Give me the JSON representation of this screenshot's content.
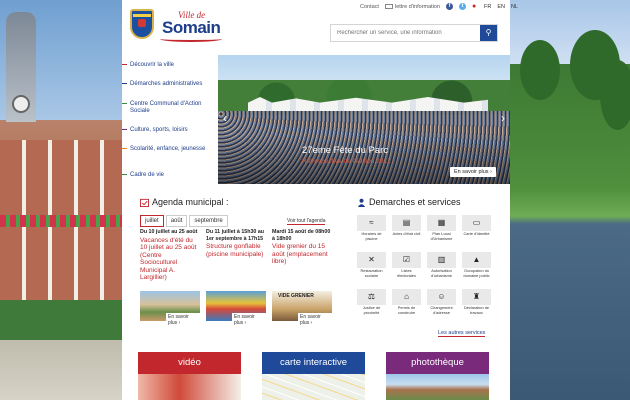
{
  "header": {
    "logo_prefix": "Ville de",
    "logo_name": "Somain",
    "utility": {
      "contact": "Contact",
      "newsletter": "lettre d'information",
      "languages": [
        "FR",
        "EN",
        "NL"
      ]
    },
    "search": {
      "placeholder": "Rechercher un service, une information"
    }
  },
  "sidebar": {
    "items": [
      {
        "label": "Découvrir la ville",
        "color": "#c1272d"
      },
      {
        "label": "Démarches administratives",
        "color": "#1e3d8a"
      },
      {
        "label": "Centre Communal d'Action Sociale",
        "color": "#3a8c3a"
      },
      {
        "label": "Culture, sports, loisirs",
        "color": "#7a2a7a"
      },
      {
        "label": "Scolarité, enfance, jeunesse",
        "color": "#e58a1f"
      },
      {
        "label": "Cadre de vie",
        "color": "#3a8c3a"
      }
    ]
  },
  "hero": {
    "title": "27eme Fête du Parc",
    "subtitle": "Rétrospective de l'édition 2017",
    "more_label": "En savoir plus  ›"
  },
  "agenda": {
    "title": "Agenda municipal :",
    "months": [
      "juillet",
      "août",
      "septembre"
    ],
    "active_month": "juillet",
    "view_all": "Voir tout l'agenda",
    "events": [
      {
        "date": "Du 10 juillet au 25 août",
        "title": "Vacances d'été du 10 juillet au 25 août (Centre Socioculturel Municipal A. Largillier)",
        "more": "En savoir plus  ›"
      },
      {
        "date": "Du 11 juillet à 15h30 au 1er septembre à 17h15",
        "title": "Structure gonflable (piscine municipale)",
        "more": "En savoir plus  ›"
      },
      {
        "date": "Mardi 15 août de 08h00 à 18h00",
        "title": "Vide grenier du 15 août (emplacement libre)",
        "more": "En savoir plus  ›",
        "thumb_text": "VIDE GRENIER"
      }
    ]
  },
  "demarches": {
    "title": "Demarches et services",
    "items": [
      {
        "label": "Horaires de piscine",
        "icon": "pool-icon",
        "glyph": "≈"
      },
      {
        "label": "Actes d'état civil",
        "icon": "document-icon",
        "glyph": "▤"
      },
      {
        "label": "Plan Local d'Urbanisme",
        "icon": "map-icon",
        "glyph": "▦"
      },
      {
        "label": "Carte d'identité",
        "icon": "id-card-icon",
        "glyph": "▭"
      },
      {
        "label": "Restauration scolaire",
        "icon": "cutlery-icon",
        "glyph": "✕"
      },
      {
        "label": "Listes électorales",
        "icon": "ballot-icon",
        "glyph": "☑"
      },
      {
        "label": "Autorisation d'urbanisme",
        "icon": "building-icon",
        "glyph": "▥"
      },
      {
        "label": "Occupation du domaine public",
        "icon": "tent-icon",
        "glyph": "▲"
      },
      {
        "label": "Justice de proximité",
        "icon": "scales-icon",
        "glyph": "⚖"
      },
      {
        "label": "Permis de construire",
        "icon": "house-icon",
        "glyph": "⌂"
      },
      {
        "label": "Changement d'adresse",
        "icon": "people-icon",
        "glyph": "☺"
      },
      {
        "label": "Déclaration de travaux",
        "icon": "tower-icon",
        "glyph": "♜"
      }
    ],
    "more": "Les autres services"
  },
  "tiles": [
    {
      "label": "vidéo",
      "color": "#c1272d"
    },
    {
      "label": "carte interactive",
      "color": "#1e4a99"
    },
    {
      "label": "photothèque",
      "color": "#7a2a7a"
    }
  ]
}
